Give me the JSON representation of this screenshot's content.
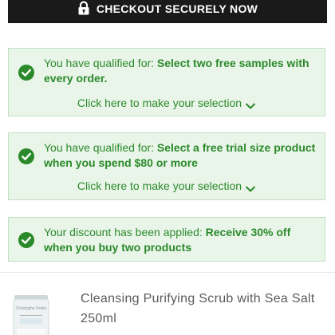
{
  "checkout": {
    "label": "CHECKOUT SECURELY NOW"
  },
  "notices": [
    {
      "prefix": "You have qualified for: ",
      "highlight": "Select two free samples with every order.",
      "link": "Click here to make your selection"
    },
    {
      "prefix": "You have qualified for: ",
      "highlight": "Select a free trial size product when you spend $80 or more",
      "link": "Click here to make your selection"
    },
    {
      "prefix": "Your discount has been applied: ",
      "highlight": "Receive 30% off when you buy two products"
    }
  ],
  "product": {
    "name": "Cleansing Purifying Scrub with Sea Salt 250ml",
    "image_label": "Christophe Robin"
  },
  "colors": {
    "checkout_bg": "#1a1a1a",
    "notice_bg": "#eaf5ea",
    "notice_border": "#bfe0bf",
    "notice_text": "#2a8a2a",
    "check_fill": "#2a8a2a"
  },
  "icons": {
    "checkout": "lock-icon",
    "notice": "check-circle-icon",
    "link": "chevron-down-icon"
  }
}
